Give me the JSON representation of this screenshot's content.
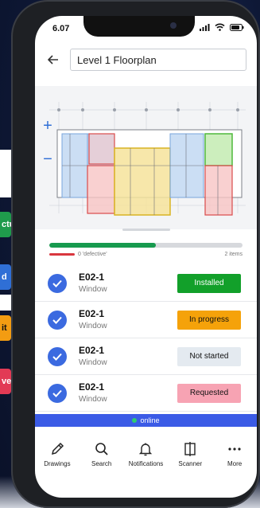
{
  "side_cards": [
    {
      "text": "ctu",
      "color": "#1f9b4c"
    },
    {
      "text": "d",
      "color": "#2f6fd6"
    },
    {
      "text": "it",
      "color": "#f39c12"
    },
    {
      "text": "ve",
      "color": "#e23a55"
    }
  ],
  "status_bar": {
    "time": "6.07"
  },
  "header": {
    "title": "Level 1 Floorplan"
  },
  "plan": {
    "zoom_in": "+",
    "zoom_out": "−"
  },
  "progress": {
    "fraction": 0.55,
    "defect_label": "0 'defective'",
    "count_label": "2 items"
  },
  "items": [
    {
      "code": "E02-1",
      "type": "Window",
      "status": "Installed",
      "bg": "#12a02a",
      "fg": "#ffffff"
    },
    {
      "code": "E02-1",
      "type": "Window",
      "status": "In progress",
      "bg": "#f5a20a",
      "fg": "#111111"
    },
    {
      "code": "E02-1",
      "type": "Window",
      "status": "Not started",
      "bg": "#e4eaf0",
      "fg": "#111111"
    },
    {
      "code": "E02-1",
      "type": "Window",
      "status": "Requested",
      "bg": "#f7a3b3",
      "fg": "#111111"
    }
  ],
  "connection": {
    "label": "online"
  },
  "tabs": [
    {
      "label": "Drawings",
      "icon": "pencil-icon"
    },
    {
      "label": "Search",
      "icon": "search-icon"
    },
    {
      "label": "Notifications",
      "icon": "bell-icon"
    },
    {
      "label": "Scanner",
      "icon": "scanner-icon"
    },
    {
      "label": "More",
      "icon": "more-icon"
    }
  ]
}
